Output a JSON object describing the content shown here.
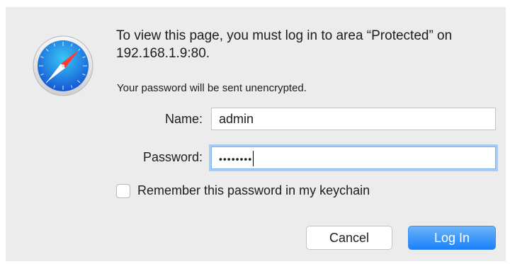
{
  "dialog": {
    "icon": "safari-compass-icon",
    "message": "To view this page, you must log in to area “Protected” on 192.168.1.9:80.",
    "warning": "Your password will be sent unencrypted."
  },
  "form": {
    "name_label": "Name:",
    "name_value": "admin",
    "password_label": "Password:",
    "password_value": "••••••••",
    "remember_label": "Remember this password in my keychain",
    "remember_checked": false
  },
  "buttons": {
    "cancel": "Cancel",
    "login": "Log In"
  },
  "colors": {
    "accent": "#1a82fb",
    "focus_ring": "#a9cbf5"
  }
}
